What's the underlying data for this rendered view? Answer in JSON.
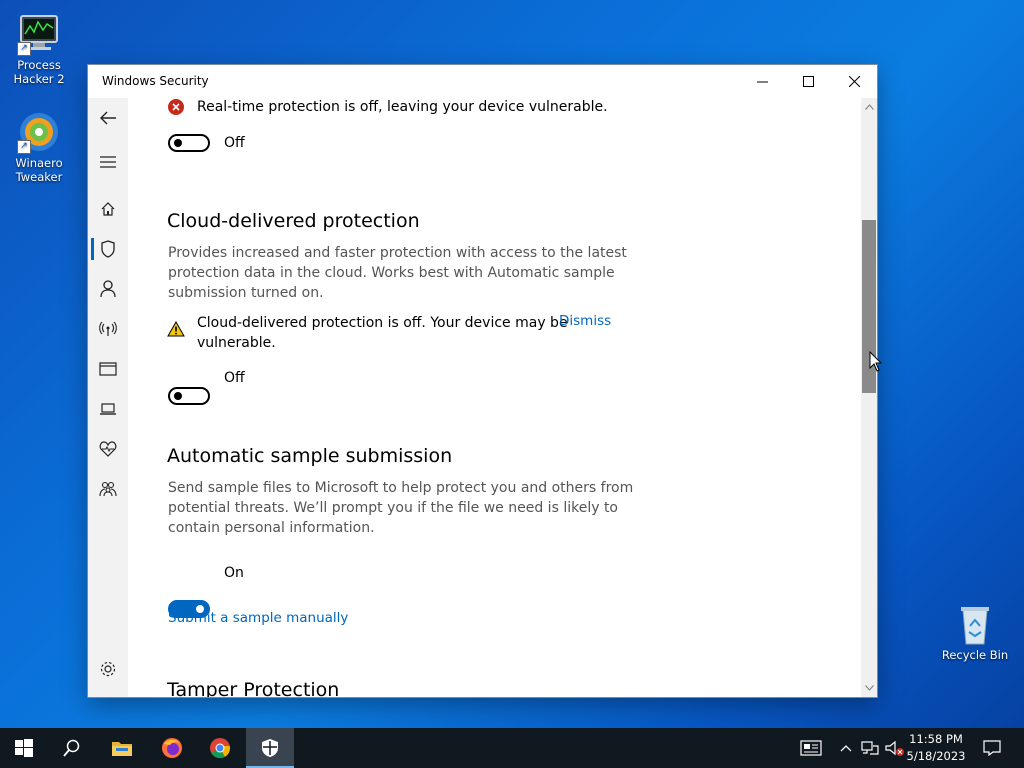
{
  "desktop": {
    "icons": [
      {
        "label_line1": "Process",
        "label_line2": "Hacker 2"
      },
      {
        "label_line1": "Winaero",
        "label_line2": "Tweaker"
      },
      {
        "label_line1": "Recycle Bin"
      }
    ]
  },
  "window": {
    "title": "Windows Security"
  },
  "content": {
    "realtime_alert": "Real-time protection is off, leaving your device vulnerable.",
    "realtime_toggle": {
      "state": "Off",
      "on": false
    },
    "cloud": {
      "heading": "Cloud-delivered protection",
      "description": "Provides increased and faster protection with access to the latest protection data in the cloud. Works best with Automatic sample submission turned on.",
      "warning_line1": "Cloud-delivered protection is off. Your device may be",
      "warning_line2": "vulnerable.",
      "dismiss": "Dismiss",
      "toggle": {
        "state": "Off",
        "on": false
      }
    },
    "sample": {
      "heading": "Automatic sample submission",
      "description": "Send sample files to Microsoft to help protect you and others from potential threats. We’ll prompt you if the file we need is likely to contain personal information.",
      "toggle": {
        "state": "On",
        "on": true
      },
      "link": "Submit a sample manually"
    },
    "tamper": {
      "heading": "Tamper Protection"
    }
  },
  "taskbar": {
    "time": "11:58 PM",
    "date": "5/18/2023"
  },
  "colors": {
    "accent": "#0067c0",
    "error": "#c42b1c",
    "warning": "#f2c811"
  }
}
